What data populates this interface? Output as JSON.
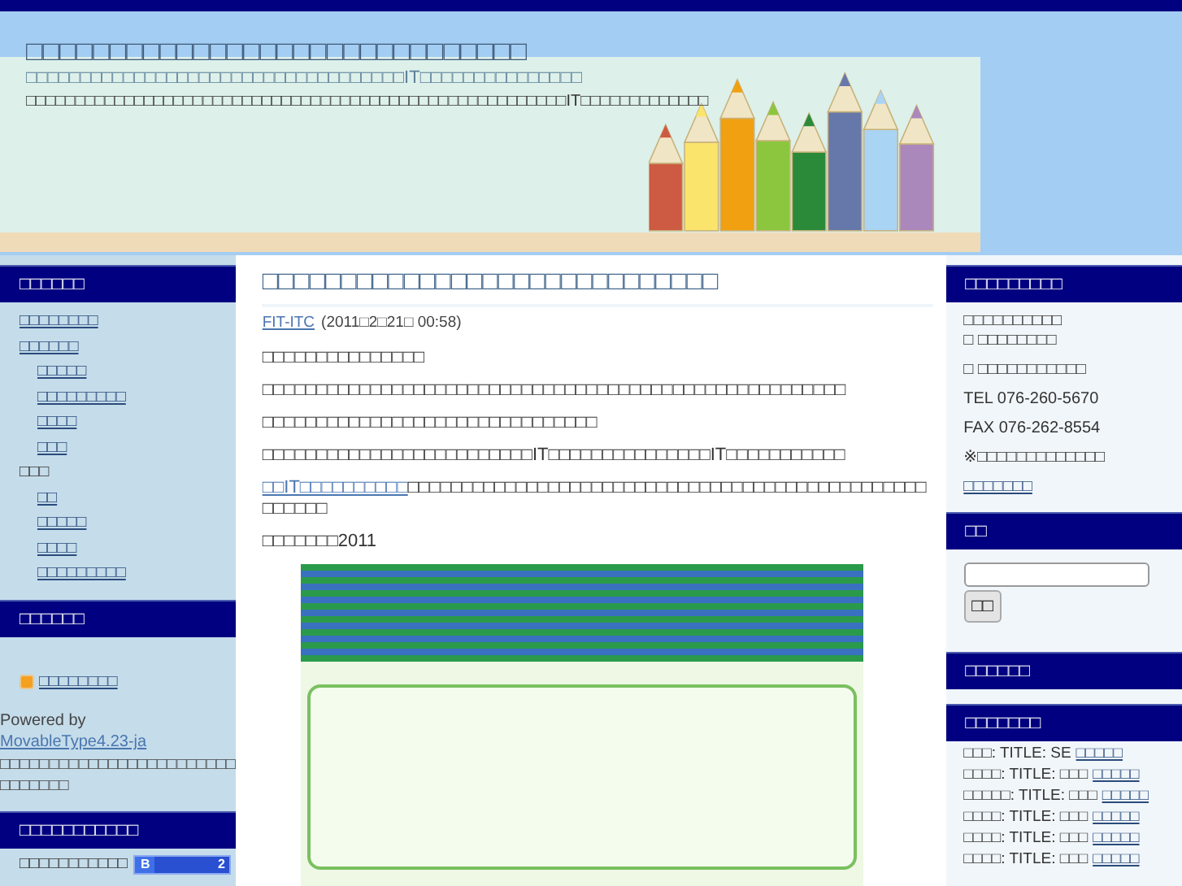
{
  "header": {
    "title": "□□□□□□□□□□□□□□□□□□□□□□□□□□□□□□",
    "tagline": "□□□□□□□□□□□□□□□□□□□□□□□□□□□□□□□□□□□IT□□□□□□□□□□□□□□□",
    "description": "□□□□□□□□□□□□□□□□□□□□□□□□□□□□□□□□□□□□□□□□□□□□□□□□□□□□□□□IT□□□□□□□□□□□□□"
  },
  "left_sidebar": {
    "categories": {
      "heading": "□□□□□□",
      "items": [
        {
          "label": "□□□□□□□□",
          "link": true
        },
        {
          "label": "□□□□□□",
          "link": true,
          "children": [
            {
              "label": "□□□□□",
              "link": true
            },
            {
              "label": "□□□□□□□□□",
              "link": true
            },
            {
              "label": "□□□□",
              "link": true
            },
            {
              "label": "□□□",
              "link": true
            }
          ]
        },
        {
          "label": "□□□",
          "link": false,
          "children": [
            {
              "label": "□□",
              "link": true
            },
            {
              "label": "□□□□□",
              "link": true
            },
            {
              "label": "□□□□",
              "link": true
            },
            {
              "label": "□□□□□□□□□",
              "link": true
            }
          ]
        }
      ]
    },
    "feed": {
      "heading": "□□□□□□",
      "link": "□□□□□□□□"
    },
    "powered": {
      "text": "Powered by",
      "link": "MovableType4.23-ja",
      "note": "□□□□□□□□□□□□□□□□□□□□□□□□□□□□□□□"
    },
    "bookmarks": {
      "heading": "□□□□□□□□□□□",
      "label": "□□□□□□□□□□□",
      "badge_letter": "B",
      "badge_count": "2"
    }
  },
  "post": {
    "title": "□□□□□□□□□□□□□□□□□□□□□□□□□□□□□",
    "author": "FIT-ITC",
    "date": "(2011□2□21□ 00:58)",
    "paragraphs": [
      {
        "text": "□□□□□□□□□□□□□□□"
      },
      {
        "text": "□□□□□□□□□□□□□□□□□□□□□□□□□□□□□□□□□□□□□□□□□□□□□□□□□□□□□□"
      },
      {
        "text": "□□□□□□□□□□□□□□□□□□□□□□□□□□□□□□□"
      },
      {
        "text": "□□□□□□□□□□□□□□□□□□□□□□□□□IT□□□□□□□□□□□□□□□IT□□□□□□□□□□□"
      },
      {
        "link": "□□IT□□□□□□□□□□",
        "text": "□□□□□□□□□□□□□□□□□□□□□□□□□□□□□□□□□□□□□□□□□□□□□□□□□□□□□□"
      },
      {
        "text": "□□□□□□□2011"
      }
    ]
  },
  "right_sidebar": {
    "contact": {
      "heading": "□□□□□□□□□",
      "lines": [
        "□□□□□□□□□□\n□ □□□□□□□□",
        "□ □□□□□□□□□□□",
        "TEL 076-260-5670",
        "FAX 076-262-8554",
        "※□□□□□□□□□□□□□"
      ],
      "link": "□□□□□□□"
    },
    "search": {
      "heading": "□□",
      "button": "□□"
    },
    "empty_section": {
      "heading": "□□□□□□"
    },
    "recent_comments": {
      "heading": "□□□□□□□",
      "items": [
        {
          "text": "□□□: TITLE: SE",
          "link": "□□□□□"
        },
        {
          "text": "□□□□: TITLE: □□□",
          "link": "□□□□□"
        },
        {
          "text": "□□□□□: TITLE: □□□",
          "link": "□□□□□"
        },
        {
          "text": "□□□□: TITLE: □□□",
          "link": "□□□□□"
        },
        {
          "text": "□□□□: TITLE: □□□",
          "link": "□□□□□"
        },
        {
          "text": "□□□□: TITLE: □□□",
          "link": "□□□□□"
        }
      ]
    }
  }
}
